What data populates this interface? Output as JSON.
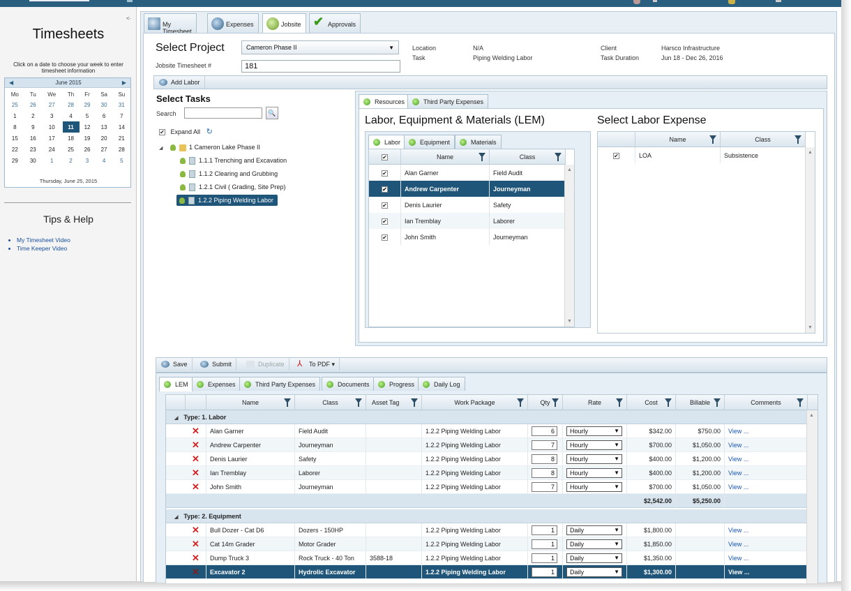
{
  "sidebar": {
    "title": "Timesheets",
    "instruction": "Click on a date to choose your week to enter timesheet information",
    "calendar": {
      "month": "June 2015",
      "prev": "◀",
      "next": "▶",
      "weekdays": [
        "Mo",
        "Tu",
        "We",
        "Th",
        "Fr",
        "Sa",
        "Su"
      ],
      "weeks": [
        [
          "25",
          "26",
          "27",
          "28",
          "29",
          "30",
          "31"
        ],
        [
          "1",
          "2",
          "3",
          "4",
          "5",
          "6",
          "7"
        ],
        [
          "8",
          "9",
          "10",
          "11",
          "12",
          "13",
          "14"
        ],
        [
          "15",
          "16",
          "17",
          "18",
          "19",
          "20",
          "21"
        ],
        [
          "22",
          "23",
          "24",
          "25",
          "26",
          "27",
          "28"
        ],
        [
          "29",
          "30",
          "1",
          "2",
          "3",
          "4",
          "5"
        ]
      ],
      "selected": "11",
      "footer": "Thursday, June 25, 2015"
    },
    "tips_title": "Tips & Help",
    "tips": [
      "My Timesheet Video",
      "Time Keeper Video"
    ],
    "collapse": "<·"
  },
  "tabs": {
    "my_timesheet": "My Timesheet",
    "expenses": "Expenses",
    "jobsite": "Jobsite",
    "approvals": "Approvals"
  },
  "project": {
    "select_label": "Select Project",
    "selected": "Cameron Phase II",
    "jobsite_label": "Jobsite Timesheet #",
    "jobsite_number": "181",
    "location_label": "Location",
    "location": "N/A",
    "task_label": "Task",
    "task": "Piping Welding Labor",
    "client_label": "Client",
    "client": "Harsco Infrastructure",
    "duration_label": "Task Duration",
    "duration": "Jun 18 - Dec 26, 2016"
  },
  "toolbar": {
    "add_labor": "Add Labor"
  },
  "tasks": {
    "title": "Select Tasks",
    "search_label": "Search",
    "search_value": "",
    "expand_all": "Expand All",
    "tree": [
      "1 Cameron Lake Phase II",
      "1.1.1 Trenching and Excavation",
      "1.1.2 Clearing and Grubbing",
      "1.2.1 Civil ( Grading, Site Prep)",
      "1.2.2 Piping Welding Labor"
    ]
  },
  "resources": {
    "tabs": [
      "Resources",
      "Third Party Expenses"
    ],
    "lem_title": "Labor, Equipment & Materials (LEM)",
    "lem_tabs": [
      "Labor",
      "Equipment",
      "Materials"
    ],
    "lem_headers": [
      "Name",
      "Class"
    ],
    "lem_rows": [
      {
        "name": "Alan Garner",
        "class": "Field Audit"
      },
      {
        "name": "Andrew Carpenter",
        "class": "Journeyman"
      },
      {
        "name": "Denis Laurier",
        "class": "Safety"
      },
      {
        "name": "Ian Tremblay",
        "class": "Laborer"
      },
      {
        "name": "John Smith",
        "class": "Journeyman"
      }
    ],
    "labor_expense_title": "Select Labor Expense",
    "labor_expense_headers": [
      "Name",
      "Class"
    ],
    "labor_expense_rows": [
      {
        "name": "LOA",
        "class": "Subsistence"
      }
    ]
  },
  "bottom": {
    "toolbar": {
      "save": "Save",
      "submit": "Submit",
      "duplicate": "Duplicate",
      "pdf": "To PDF ▾"
    },
    "tabs": [
      "LEM",
      "Expenses",
      "Third Party Expenses",
      "Documents",
      "Progress",
      "Daily Log"
    ],
    "headers": [
      "Name",
      "Class",
      "Asset Tag",
      "Work Package",
      "Qty",
      "Rate",
      "Cost",
      "Billable",
      "Comments"
    ],
    "group_labor": "Type: 1. Labor",
    "labor_rows": [
      {
        "name": "Alan Garner",
        "class": "Field Audit",
        "asset": "",
        "wp": "1.2.2 Piping Welding Labor",
        "qty": "6",
        "rate": "Hourly",
        "cost": "$342.00",
        "billable": "$750.00",
        "comments": "View ..."
      },
      {
        "name": "Andrew Carpenter",
        "class": "Journeyman",
        "asset": "",
        "wp": "1.2.2 Piping Welding Labor",
        "qty": "7",
        "rate": "Hourly",
        "cost": "$700.00",
        "billable": "$1,050.00",
        "comments": "View ..."
      },
      {
        "name": "Denis Laurier",
        "class": "Safety",
        "asset": "",
        "wp": "1.2.2 Piping Welding Labor",
        "qty": "8",
        "rate": "Hourly",
        "cost": "$400.00",
        "billable": "$1,200.00",
        "comments": "View ..."
      },
      {
        "name": "Ian Tremblay",
        "class": "Laborer",
        "asset": "",
        "wp": "1.2.2 Piping Welding Labor",
        "qty": "8",
        "rate": "Hourly",
        "cost": "$400.00",
        "billable": "$1,200.00",
        "comments": "View ..."
      },
      {
        "name": "John Smith",
        "class": "Journeyman",
        "asset": "",
        "wp": "1.2.2 Piping Welding Labor",
        "qty": "7",
        "rate": "Hourly",
        "cost": "$700.00",
        "billable": "$1,050.00",
        "comments": "View ..."
      }
    ],
    "labor_total_cost": "$2,542.00",
    "labor_total_billable": "$5,250.00",
    "group_equipment": "Type: 2. Equipment",
    "equipment_rows": [
      {
        "name": "Bull Dozer - Cat D6",
        "class": "Dozers - 150HP",
        "asset": "",
        "wp": "1.2.2 Piping Welding Labor",
        "qty": "1",
        "rate": "Daily",
        "cost": "$1,800.00",
        "billable": "",
        "comments": "View ..."
      },
      {
        "name": "Cat 14m Grader",
        "class": "Motor Grader",
        "asset": "",
        "wp": "1.2.2 Piping Welding Labor",
        "qty": "1",
        "rate": "Daily",
        "cost": "$1,850.00",
        "billable": "",
        "comments": "View ..."
      },
      {
        "name": "Dump Truck 3",
        "class": "Rock Truck - 40 Ton",
        "asset": "3588-18",
        "wp": "1.2.2 Piping Welding Labor",
        "qty": "1",
        "rate": "Daily",
        "cost": "$1,350.00",
        "billable": "",
        "comments": "View ..."
      },
      {
        "name": "Excavator 2",
        "class": "Hydrolic Excavator",
        "asset": "",
        "wp": "1.2.2 Piping Welding Labor",
        "qty": "1",
        "rate": "Daily",
        "cost": "$1,300.00",
        "billable": "",
        "comments": "View ..."
      }
    ]
  }
}
